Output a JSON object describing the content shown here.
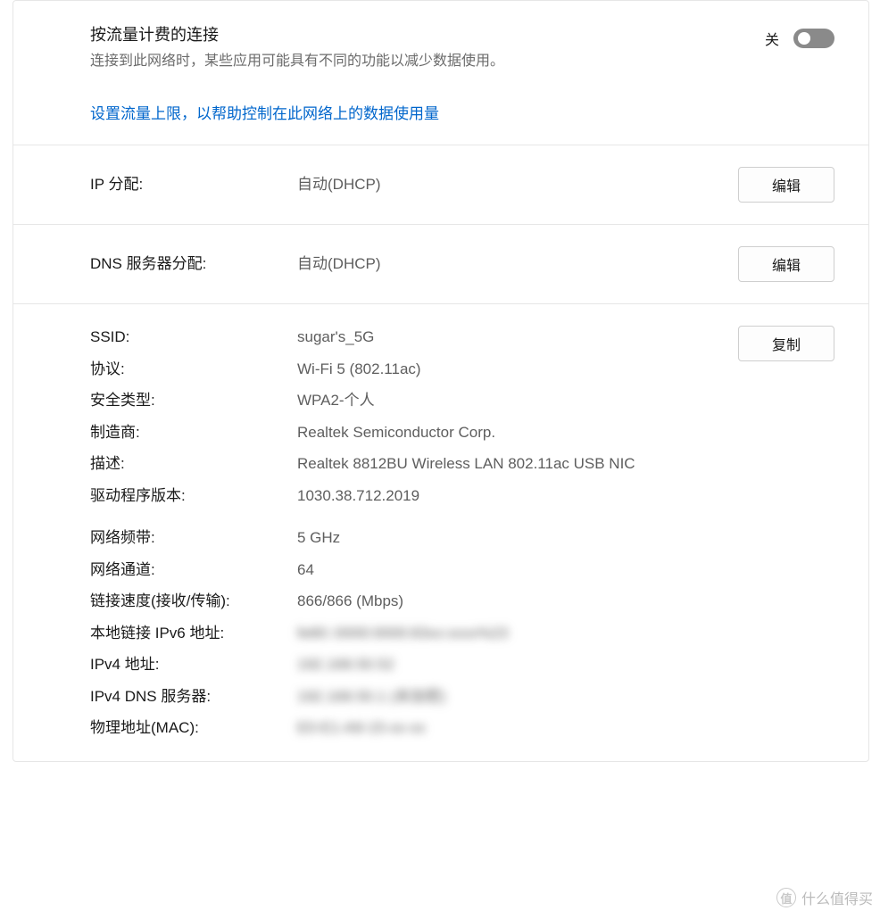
{
  "metered": {
    "title": "按流量计费的连接",
    "description": "连接到此网络时，某些应用可能具有不同的功能以减少数据使用。",
    "toggle_state_label": "关",
    "link": "设置流量上限，以帮助控制在此网络上的数据使用量"
  },
  "ip": {
    "label": "IP 分配:",
    "value": "自动(DHCP)",
    "edit_button": "编辑"
  },
  "dns": {
    "label": "DNS 服务器分配:",
    "value": "自动(DHCP)",
    "edit_button": "编辑"
  },
  "details": {
    "copy_button": "复制",
    "rows": [
      {
        "label": "SSID:",
        "value": "sugar's_5G",
        "blur": false
      },
      {
        "label": "协议:",
        "value": "Wi-Fi 5 (802.11ac)",
        "blur": false
      },
      {
        "label": "安全类型:",
        "value": "WPA2-个人",
        "blur": false
      },
      {
        "label": "制造商:",
        "value": "Realtek Semiconductor Corp.",
        "blur": false
      },
      {
        "label": "描述:",
        "value": "Realtek 8812BU Wireless LAN 802.11ac USB NIC",
        "blur": false
      },
      {
        "label": "驱动程序版本:",
        "value": "1030.38.712.2019",
        "blur": false
      }
    ],
    "rows2": [
      {
        "label": "网络频带:",
        "value": "5 GHz",
        "blur": false
      },
      {
        "label": "网络通道:",
        "value": "64",
        "blur": false
      },
      {
        "label": "链接速度(接收/传输):",
        "value": "866/866 (Mbps)",
        "blur": false
      },
      {
        "label": "本地链接 IPv6 地址:",
        "value": "fe80::0000:0000:83xx:xxxx%23",
        "blur": true
      },
      {
        "label": "IPv4 地址:",
        "value": "192.168.50.52",
        "blur": true
      },
      {
        "label": "IPv4 DNS 服务器:",
        "value": "192.168.50.1 (未加密)",
        "blur": true
      },
      {
        "label": "物理地址(MAC):",
        "value": "E0-E1-A9-15-xx-xx",
        "blur": true
      }
    ]
  },
  "watermark": {
    "brand": "什么值得买",
    "coin": "值"
  }
}
